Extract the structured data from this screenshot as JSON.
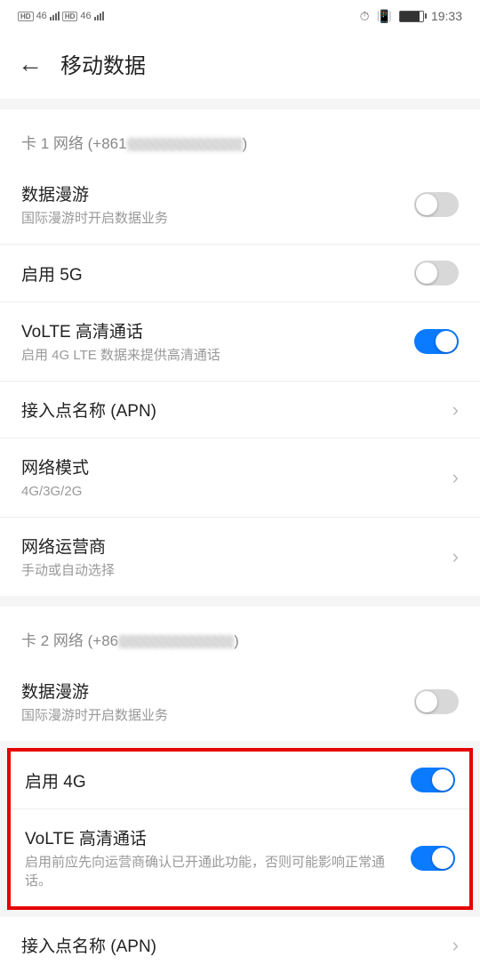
{
  "statusBar": {
    "time": "19:33",
    "sigLabel": "46"
  },
  "header": {
    "title": "移动数据"
  },
  "sim1": {
    "header": "卡 1 网络 (+861",
    "headerSuffix": ")",
    "roaming": {
      "title": "数据漫游",
      "sub": "国际漫游时开启数据业务",
      "on": false
    },
    "enable5g": {
      "title": "启用 5G",
      "on": false
    },
    "volte": {
      "title": "VoLTE 高清通话",
      "sub": "启用 4G LTE 数据来提供高清通话",
      "on": true
    },
    "apn": {
      "title": "接入点名称 (APN)"
    },
    "netmode": {
      "title": "网络模式",
      "sub": "4G/3G/2G"
    },
    "carrier": {
      "title": "网络运营商",
      "sub": "手动或自动选择"
    }
  },
  "sim2": {
    "header": "卡 2 网络 (+86",
    "headerSuffix": ")",
    "roaming": {
      "title": "数据漫游",
      "sub": "国际漫游时开启数据业务",
      "on": false
    },
    "enable4g": {
      "title": "启用 4G",
      "on": true
    },
    "volte": {
      "title": "VoLTE 高清通话",
      "sub": "启用前应先向运营商确认已开通此功能，否则可能影响正常通话。",
      "on": true
    },
    "apn": {
      "title": "接入点名称 (APN)"
    }
  }
}
